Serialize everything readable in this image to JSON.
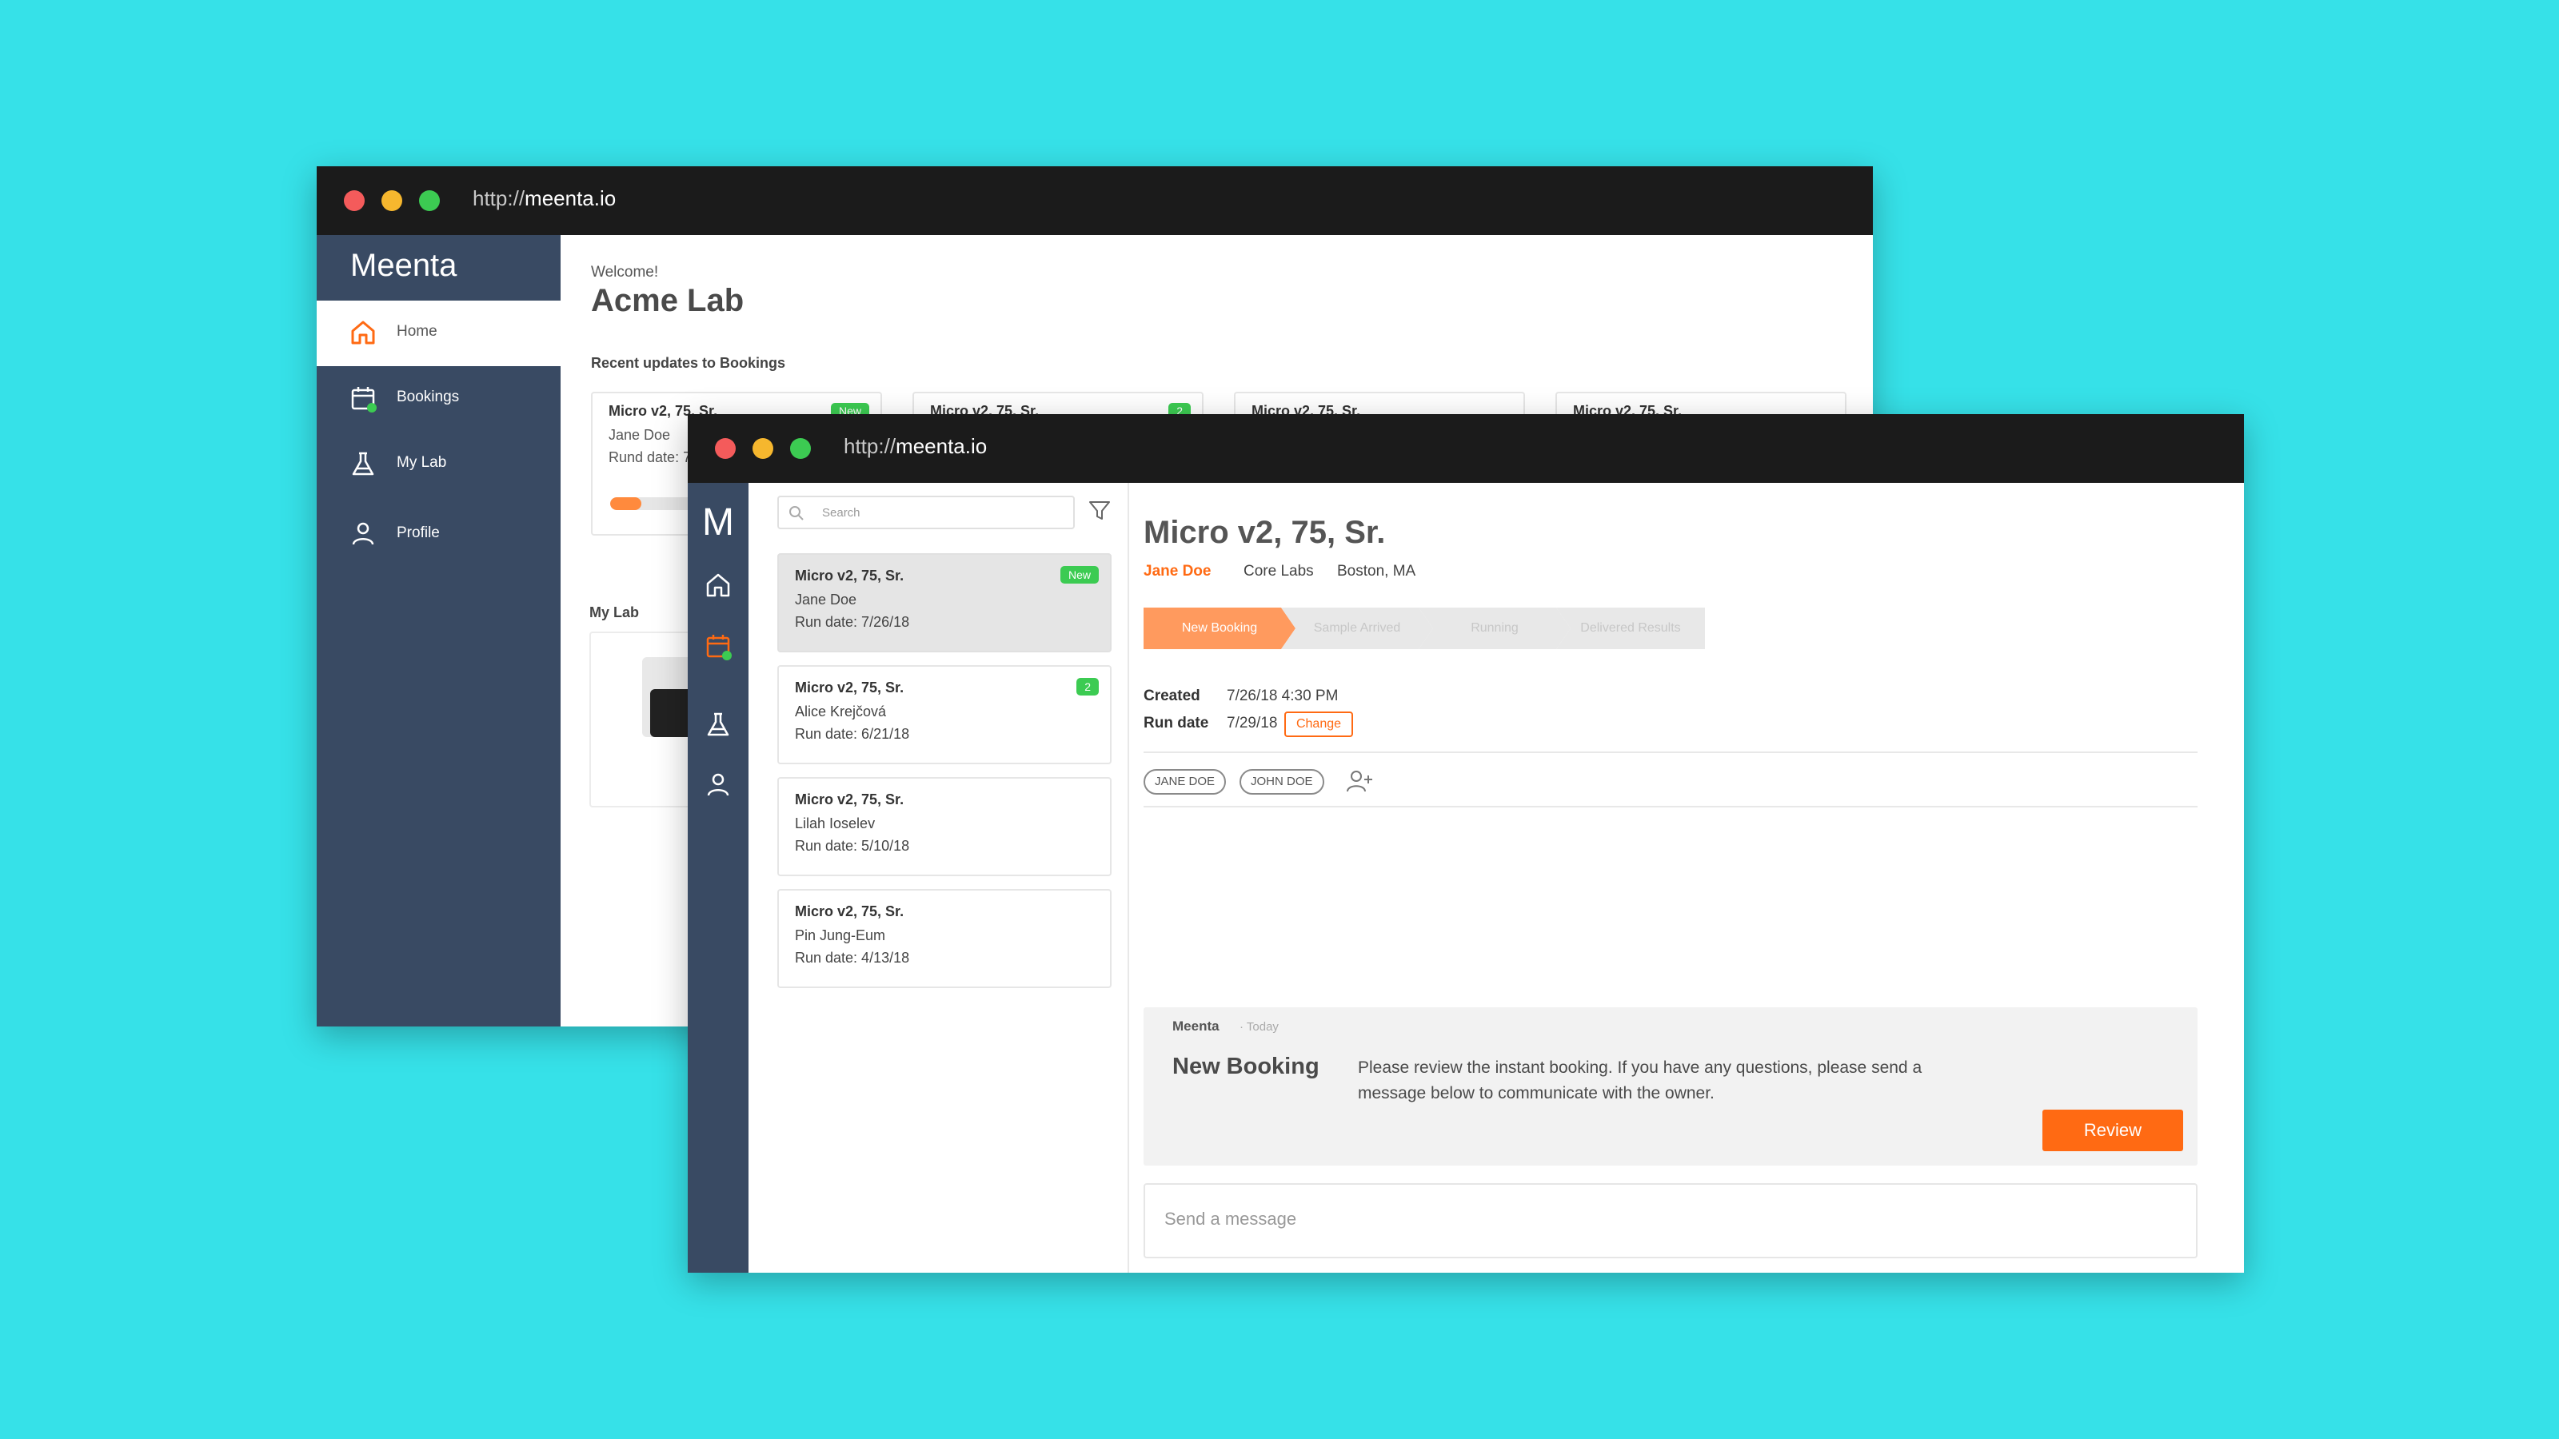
{
  "colors": {
    "background": "#36e1e8",
    "sidebar": "#394a63",
    "accent": "#ff6a13",
    "new_badge": "#3ccb52"
  },
  "back_window": {
    "url_prefix": "http://",
    "url_host": "meenta.io",
    "logo": "Meenta",
    "nav": [
      {
        "label": "Home",
        "icon": "home-icon",
        "active": true
      },
      {
        "label": "Bookings",
        "icon": "calendar-icon"
      },
      {
        "label": "My Lab",
        "icon": "flask-icon"
      },
      {
        "label": "Profile",
        "icon": "user-icon"
      }
    ],
    "welcome": "Welcome!",
    "lab_name": "Acme Lab",
    "recent_label": "Recent updates to Bookings",
    "cards": [
      {
        "title": "Micro v2, 75, Sr.",
        "owner": "Jane Doe",
        "run": "Rund date: 7/26/18",
        "badge": "New",
        "progress": 0.35
      },
      {
        "title": "Micro v2, 75, Sr.",
        "badge": "2"
      },
      {
        "title": "Micro v2, 75, Sr."
      },
      {
        "title": "Micro v2, 75, Sr."
      }
    ],
    "mylab_label": "My Lab"
  },
  "front_window": {
    "url_prefix": "http://",
    "url_host": "meenta.io",
    "rail_logo": "M",
    "search_placeholder": "Search",
    "bookings": [
      {
        "title": "Micro v2, 75, Sr.",
        "owner": "Jane Doe",
        "run": "Run date: 7/26/18",
        "badge": "New",
        "selected": true
      },
      {
        "title": "Micro v2, 75, Sr.",
        "owner": "Alice Krejčová",
        "run": "Run date: 6/21/18",
        "badge": "2"
      },
      {
        "title": "Micro v2, 75, Sr.",
        "owner": "Lilah Ioselev",
        "run": "Run date: 5/10/18"
      },
      {
        "title": "Micro v2, 75, Sr.",
        "owner": "Pin Jung-Eum",
        "run": "Run date: 4/13/18"
      }
    ],
    "detail": {
      "title": "Micro v2, 75, Sr.",
      "owner": "Jane Doe",
      "lab": "Core Labs",
      "location": "Boston, MA",
      "steps": [
        "New Booking",
        "Sample Arrived",
        "Running",
        "Delivered Results"
      ],
      "active_step": "New Booking",
      "created_label": "Created",
      "created_value": "7/26/18 4:30 PM",
      "run_label": "Run date",
      "run_value": "7/29/18",
      "change_label": "Change",
      "members": [
        "JANE DOE",
        "JOHN DOE"
      ],
      "message": {
        "sender": "Meenta",
        "time": "· Today",
        "title": "New Booking",
        "text": "Please review the instant booking. If you have any questions, please send a message below to communicate with the owner.",
        "button": "Review"
      },
      "send_placeholder": "Send a message"
    }
  }
}
